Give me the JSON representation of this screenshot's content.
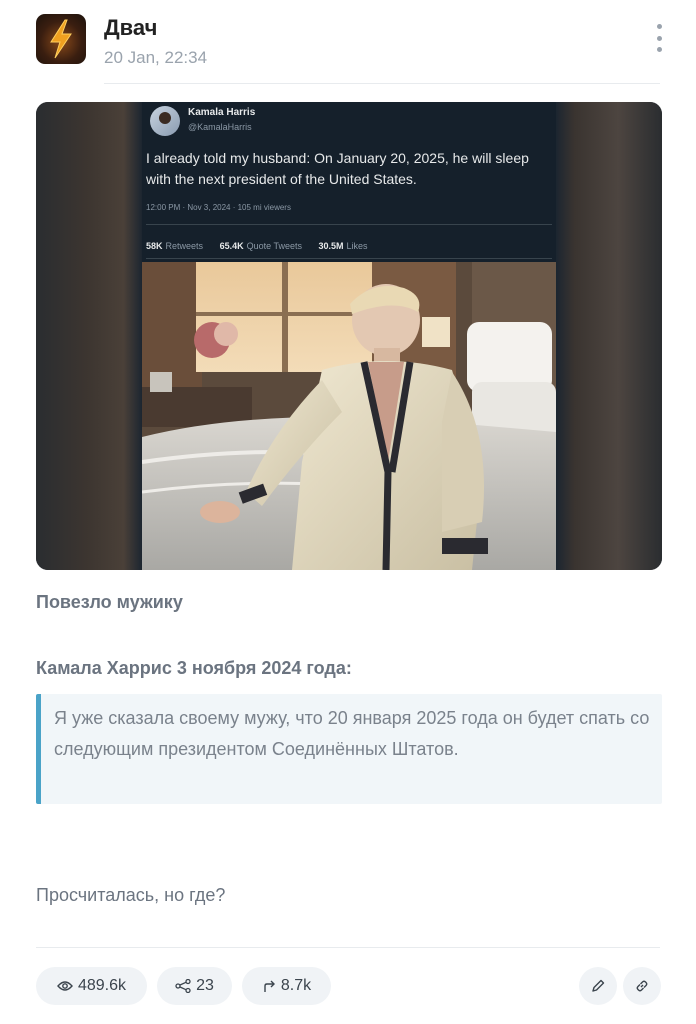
{
  "header": {
    "channel_name": "Двач",
    "date": "20 Jan, 22:34",
    "avatar_icon": "lightning-bolt-logo",
    "menu_icon": "more-vertical-icon"
  },
  "tweet": {
    "name": "Kamala Harris",
    "handle": "@KamalaHarris",
    "text": "I already told my husband: On January 20, 2025, he will sleep with the next president of the United States.",
    "meta": "12:00 PM · Nov 3, 2024 · 105 mi viewers",
    "stats": [
      {
        "value": "58K",
        "label": "Retweets"
      },
      {
        "value": "65.4K",
        "label": "Quote Tweets"
      },
      {
        "value": "30.5M",
        "label": "Likes"
      }
    ]
  },
  "post": {
    "caption": "Повезло мужику",
    "quote_title": "Камала Харрис 3 ноября 2024 года:",
    "quote_text": "Я уже сказала своему мужу, что 20 января 2025 года он будет спать со следующим президентом Соединённых Штатов.",
    "footer": "Просчиталась, но где?"
  },
  "actions": {
    "views": "489.6k",
    "shares": "23",
    "forwards": "8.7k",
    "icons": [
      "eye-icon",
      "share-icon",
      "forward-icon",
      "pencil-icon",
      "link-icon"
    ]
  },
  "colors": {
    "accent": "#4aa3c8",
    "muted_text": "#6b7480",
    "pill_bg": "#f0f3f6",
    "quote_bg": "#f1f6f9"
  }
}
